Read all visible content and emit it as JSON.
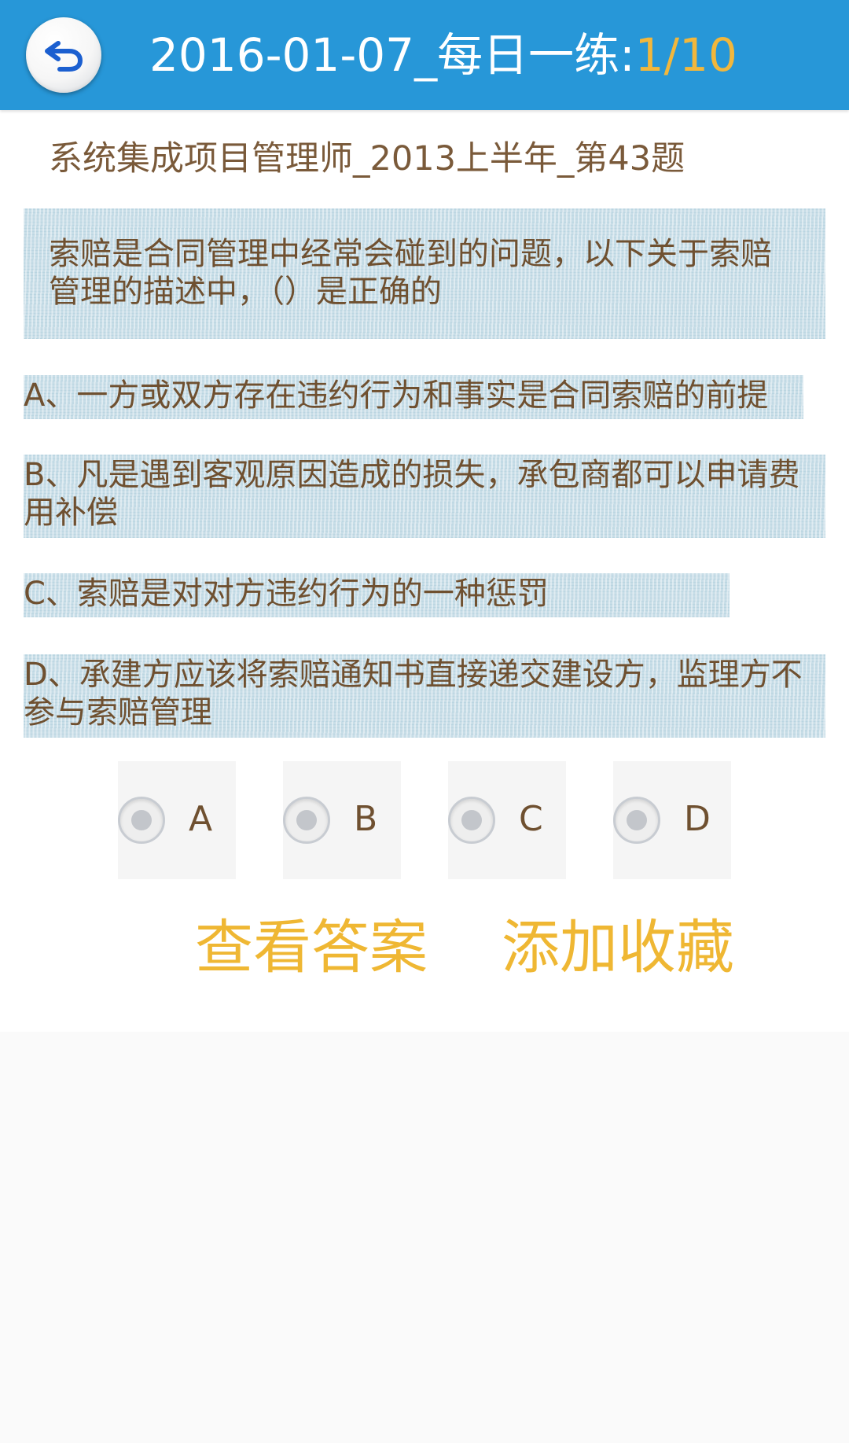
{
  "header": {
    "title": "2016-01-07_每日一练:",
    "progress": "1/10",
    "back_icon": "back-arrow-icon"
  },
  "question": {
    "source": "系统集成项目管理师_2013上半年_第43题",
    "stem": "索赔是合同管理中经常会碰到的问题，以下关于索赔管理的描述中，（）是正确的",
    "options": [
      {
        "text": "A、一方或双方存在违约行为和事实是合同索赔的前提"
      },
      {
        "text": "B、凡是遇到客观原因造成的损失，承包商都可以申请费用补偿"
      },
      {
        "text": "C、索赔是对对方违约行为的一种惩罚"
      },
      {
        "text": "D、承建方应该将索赔通知书直接递交建设方，监理方不参与索赔管理"
      }
    ]
  },
  "answer_choices": [
    {
      "label": "A"
    },
    {
      "label": "B"
    },
    {
      "label": "C"
    },
    {
      "label": "D"
    }
  ],
  "actions": {
    "view_answer": "查看答案",
    "add_favorite": "添加收藏"
  },
  "colors": {
    "header_bg": "#2797d8",
    "accent": "#efb733",
    "text_brown": "#6f5030",
    "option_bg": "#c7dde7"
  }
}
